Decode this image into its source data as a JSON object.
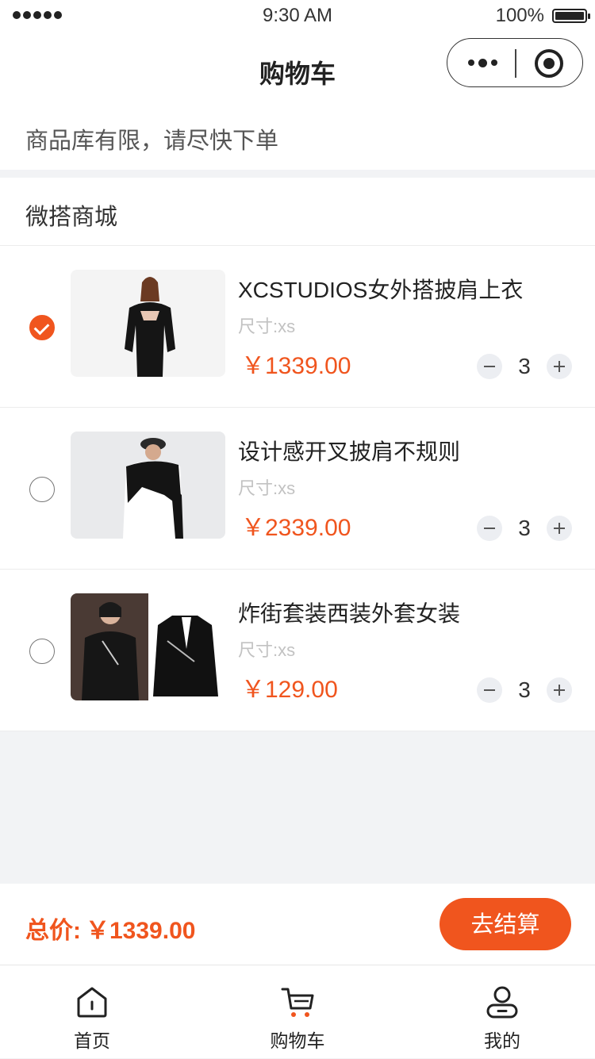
{
  "status_bar": {
    "time": "9:30 AM",
    "battery": "100%"
  },
  "nav": {
    "title": "购物车"
  },
  "notice": "商品库有限，请尽快下单",
  "store": {
    "name": "微搭商城"
  },
  "items": [
    {
      "title": "XCSTUDIOS女外搭披肩上衣",
      "size": "尺寸:xs",
      "price": "￥1339.00",
      "qty": "3",
      "checked": true
    },
    {
      "title": "设计感开叉披肩不规则",
      "size": "尺寸:xs",
      "price": "￥2339.00",
      "qty": "3",
      "checked": false
    },
    {
      "title": "炸街套装西装外套女装",
      "size": "尺寸:xs",
      "price": "￥129.00",
      "qty": "3",
      "checked": false
    }
  ],
  "total": {
    "label": "总价:",
    "amount": "￥1339.00"
  },
  "checkout_label": "去结算",
  "tabs": [
    {
      "label": "首页",
      "icon": "home-icon"
    },
    {
      "label": "购物车",
      "icon": "cart-icon"
    },
    {
      "label": "我的",
      "icon": "user-icon"
    }
  ],
  "colors": {
    "accent": "#f0551e",
    "background": "#f2f3f5"
  }
}
